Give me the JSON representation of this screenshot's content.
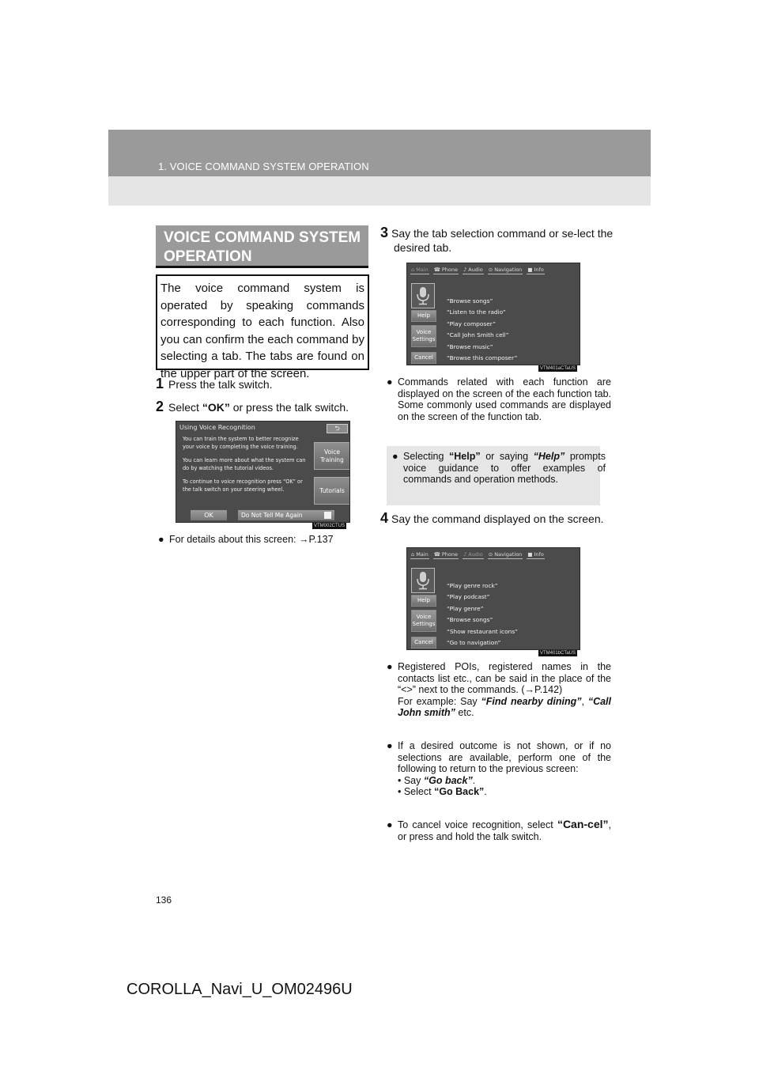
{
  "header": {
    "chapter": "1. VOICE COMMAND SYSTEM OPERATION"
  },
  "section": {
    "title_line1": "VOICE COMMAND SYSTEM",
    "title_line2": "OPERATION",
    "intro": "The voice command system is operated by speaking commands corresponding to each function. Also you can confirm the each command by selecting a tab. The tabs are found on the upper part of the screen."
  },
  "steps": {
    "s1": {
      "num": "1",
      "text": "Press the talk switch."
    },
    "s2": {
      "num": "2",
      "pre": "Select ",
      "bold": "“OK”",
      "post": " or press the talk switch."
    },
    "s3": {
      "num": "3",
      "text": "Say the tab selection command or se-lect the desired tab."
    },
    "s4": {
      "num": "4",
      "text": "Say the command displayed on the screen."
    }
  },
  "screen1": {
    "title": "Using Voice Recognition",
    "back_icon": "⮌",
    "msg1": "You can train the system to better recognize your voice by completing the voice training.",
    "msg2": "You can learn more about what the system can do by watching the tutorial videos.",
    "msg3": "To continue to voice recognition press “OK” or the talk switch on your steering wheel.",
    "voice_training_1": "Voice",
    "voice_training_2": "Training",
    "tutorials": "Tutorials",
    "ok": "OK",
    "do_not_tell": "Do Not Tell Me Again",
    "code": "VTM002CTUS"
  },
  "bullet_details": {
    "text": "For details about this screen: ",
    "ref": "→P.137"
  },
  "tabs": {
    "main": "⌂ Main",
    "phone": "☎ Phone",
    "audio": "♪ Audio",
    "navigation": "⊙ Navigation",
    "info": "■ Info"
  },
  "side_buttons": {
    "help": "Help",
    "voice_settings_1": "Voice",
    "voice_settings_2": "Settings",
    "cancel": "Cancel"
  },
  "screen3": {
    "commands": [
      "“Browse songs”",
      "“Listen to the radio”",
      "“Play composer”",
      "“Call John Smith cell”",
      "“Browse music”",
      "“Browse this composer”"
    ],
    "code": "VTM401aCTaUS"
  },
  "screen4": {
    "commands": [
      "“Play genre rock”",
      "“Play podcast”",
      "“Play genre”",
      "“Browse songs”",
      "“Show restaurant icons”",
      "“Go to navigation”"
    ],
    "code": "VTM401bCTaUS"
  },
  "bullet_commands": "Commands related with each function are displayed on the screen of the each function tab. Some commonly used commands are displayed on the screen of the function tab.",
  "note_help": {
    "pre": "Selecting ",
    "b1": "“Help”",
    "mid": " or saying ",
    "b2": "“Help”",
    "post": " prompts voice guidance to offer examples of commands and operation methods."
  },
  "bullet_pois": {
    "text": "Registered POIs, registered names in the contacts list etc., can be said in the place of the “<>” next to the commands. (→P.142)",
    "example_pre": "For example: Say ",
    "example1": "“Find nearby dining”",
    "sep": ", ",
    "example2": "“Call John smith”",
    "post": " etc."
  },
  "bullet_outcome": {
    "text": "If a desired outcome is not shown, or if no selections are available, perform one of the following to return to the previous screen:",
    "sub1_pre": "• Say ",
    "sub1_b": "“Go back”",
    "sub1_post": ".",
    "sub2_pre": "• Select ",
    "sub2_b": "“Go Back”",
    "sub2_post": "."
  },
  "bullet_cancel": {
    "pre": "To cancel voice recognition, select ",
    "b": "“Can-cel”",
    "post": ", or press and hold the talk switch."
  },
  "footer": {
    "page_number": "136",
    "doc_code": "COROLLA_Navi_U_OM02496U"
  }
}
